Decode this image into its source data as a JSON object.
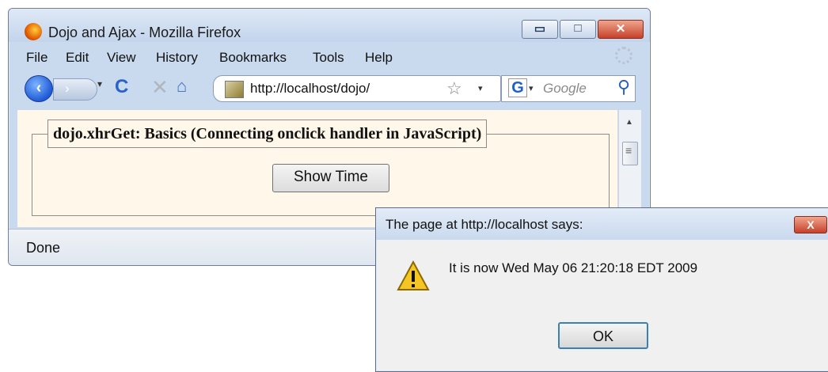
{
  "browser": {
    "title": "Dojo and Ajax - Mozilla Firefox",
    "window_buttons": {
      "minimize": "▭",
      "maximize": "□",
      "close": "✕"
    },
    "menu": [
      "File",
      "Edit",
      "View",
      "History",
      "Bookmarks",
      "Tools",
      "Help"
    ],
    "nav": {
      "back_label": "‹",
      "forward_label": "›",
      "dropdown": "▾",
      "reload": "C",
      "stop": "✕",
      "home": "⌂",
      "url": "http://localhost/dojo/",
      "star": "☆",
      "url_dropdown": "▾",
      "search_engine": "G",
      "search_placeholder": "Google",
      "search_go": "⚲"
    },
    "page": {
      "legend": "dojo.xhrGet: Basics (Connecting onclick handler in JavaScript)",
      "button_label": "Show Time"
    },
    "scrollbar": {
      "up_arrow": "▲",
      "thumb_grip": "≡"
    },
    "status": "Done"
  },
  "dialog": {
    "title": "The page at http://localhost says:",
    "close_label": "X",
    "message": "It is now Wed May 06 21:20:18 EDT 2009",
    "ok_label": "OK"
  },
  "colors": {
    "content_bg": "#fff8ea",
    "close_red": "#c6412a",
    "titlebar_blue": "#c9d9ee"
  },
  "icons": {
    "app": "firefox-icon",
    "warning": "warning-icon",
    "search": "search-icon",
    "home": "home-icon"
  }
}
